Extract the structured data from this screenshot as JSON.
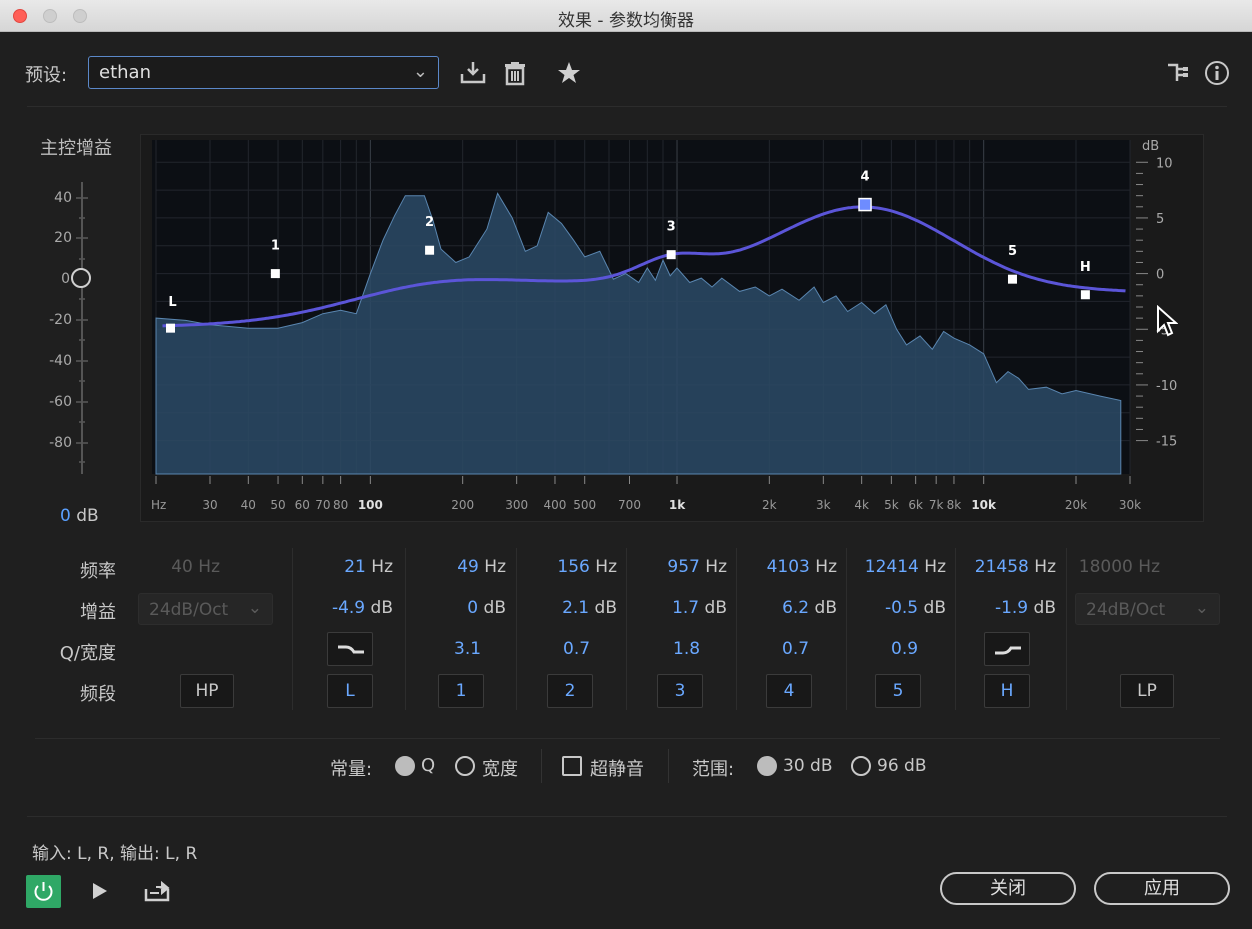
{
  "window": {
    "title": "效果 - 参数均衡器"
  },
  "preset": {
    "label": "预设:",
    "value": "ethan"
  },
  "master_gain": {
    "label": "主控增益",
    "ticks": [
      "40",
      "20",
      "0",
      "-20",
      "-40",
      "-60",
      "-80"
    ],
    "value_num": "0",
    "value_unit": "dB"
  },
  "graph": {
    "db_unit": "dB",
    "db_ticks": [
      "10",
      "5",
      "0",
      "-5",
      "-10",
      "-15"
    ],
    "freq_ticks": [
      "Hz",
      "30",
      "40",
      "50",
      "60",
      "70",
      "80",
      "100",
      "200",
      "300",
      "400",
      "500",
      "700",
      "1k",
      "2k",
      "3k",
      "4k",
      "5k",
      "6k",
      "7k",
      "8k",
      "10k",
      "20k",
      "30k"
    ],
    "node_labels": [
      "L",
      "1",
      "2",
      "3",
      "4",
      "5",
      "H"
    ]
  },
  "rows": {
    "freq": "频率",
    "gain": "增益",
    "q": "Q/宽度",
    "band": "频段"
  },
  "hp": {
    "freq_num": "40",
    "freq_unit": "Hz",
    "slope": "24dB/Oct",
    "button": "HP"
  },
  "lp": {
    "freq_num": "18000",
    "freq_unit": "Hz",
    "slope": "24dB/Oct",
    "button": "LP"
  },
  "bands": [
    {
      "button": "L",
      "freq_num": "21",
      "freq_unit": "Hz",
      "gain_num": "-4.9",
      "gain_unit": "dB",
      "q": ""
    },
    {
      "button": "1",
      "freq_num": "49",
      "freq_unit": "Hz",
      "gain_num": "0",
      "gain_unit": "dB",
      "q": "3.1"
    },
    {
      "button": "2",
      "freq_num": "156",
      "freq_unit": "Hz",
      "gain_num": "2.1",
      "gain_unit": "dB",
      "q": "0.7"
    },
    {
      "button": "3",
      "freq_num": "957",
      "freq_unit": "Hz",
      "gain_num": "1.7",
      "gain_unit": "dB",
      "q": "1.8"
    },
    {
      "button": "4",
      "freq_num": "4103",
      "freq_unit": "Hz",
      "gain_num": "6.2",
      "gain_unit": "dB",
      "q": "0.7"
    },
    {
      "button": "5",
      "freq_num": "12414",
      "freq_unit": "Hz",
      "gain_num": "-0.5",
      "gain_unit": "dB",
      "q": "0.9"
    },
    {
      "button": "H",
      "freq_num": "21458",
      "freq_unit": "Hz",
      "gain_num": "-1.9",
      "gain_unit": "dB",
      "q": ""
    }
  ],
  "options": {
    "constant_label": "常量:",
    "q_label": "Q",
    "width_label": "宽度",
    "ultra_quiet_label": "超静音",
    "range_label": "范围:",
    "range_30": "30 dB",
    "range_96": "96 dB"
  },
  "io": {
    "text": "输入: L, R,  输出: L, R"
  },
  "buttons": {
    "close": "关闭",
    "apply": "应用"
  },
  "colors": {
    "accent": "#5a9cff",
    "curve": "#5b55d8",
    "power": "#2fa866"
  }
}
